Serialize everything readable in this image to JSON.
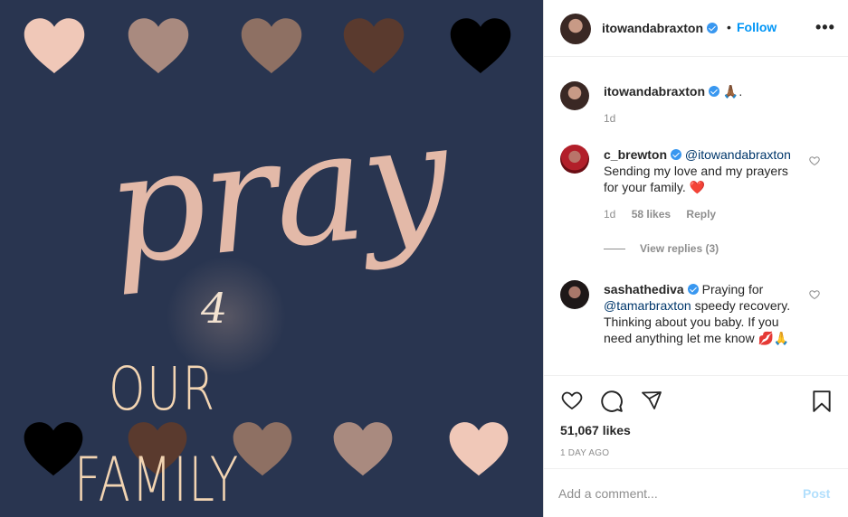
{
  "colors": {
    "image_bg": "#293550",
    "script_text": "#e3b9a8",
    "caps_text": "#f2d4b2",
    "link_blue": "#0095f6",
    "mention": "#00376b",
    "muted": "#8e8e8e",
    "post_disabled": "#b2dffc"
  },
  "image": {
    "script_word": "pray",
    "script_four": "4",
    "caps_line1": "OUR",
    "caps_line2": "FAMILY",
    "top_hearts": [
      "#f0c8b8",
      "#a98a7f",
      "#8e7063",
      "#5a3a2e",
      "#000000"
    ],
    "bottom_hearts": [
      "#000000",
      "#5a3a2e",
      "#8e7063",
      "#a98a7f",
      "#f0c8b8"
    ]
  },
  "header": {
    "username": "itowandabraxton",
    "dot": "•",
    "follow_label": "Follow",
    "more_icon": "more-options-icon"
  },
  "caption": {
    "username": "itowandabraxton",
    "text": "🙏🏾.",
    "time": "1d"
  },
  "comments": [
    {
      "username": "c_brewton",
      "mention": "@itowandabraxton",
      "text": "Sending my love and my prayers for your family. ❤️",
      "time": "1d",
      "likes": "58 likes",
      "reply_label": "Reply",
      "view_replies": "View replies (3)"
    },
    {
      "username": "sashathediva",
      "text_before": "Praying for",
      "mention": "@tamarbraxton",
      "text_after": "speedy recovery. Thinking about you baby. If you need anything let me know 💋🙏"
    }
  ],
  "actions": {
    "like_icon": "heart-outline-icon",
    "comment_icon": "comment-bubble-icon",
    "share_icon": "paper-plane-icon",
    "save_icon": "bookmark-icon",
    "likes_text": "51,067 likes",
    "time_ago": "1 DAY AGO"
  },
  "add_comment": {
    "placeholder": "Add a comment...",
    "post_label": "Post"
  }
}
